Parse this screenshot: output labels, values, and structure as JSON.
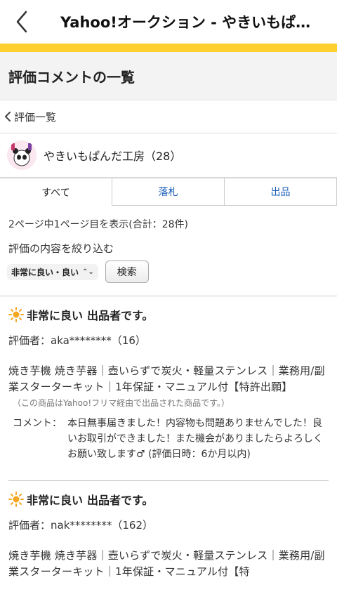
{
  "app": {
    "title": "Yahoo!オークション - やきいもぱ…"
  },
  "header": {
    "title": "評価コメントの一覧"
  },
  "breadcrumb": {
    "label": "評価一覧"
  },
  "seller": {
    "name": "やきいもぱんだ工房（28）"
  },
  "tabs": [
    {
      "label": "すべて",
      "active": true
    },
    {
      "label": "落札",
      "active": false
    },
    {
      "label": "出品",
      "active": false
    }
  ],
  "summary": {
    "text": "2ページ中1ページ目を表示(合計：28件)"
  },
  "filter": {
    "label": "評価の内容を絞り込む",
    "selected": "非常に良い・良い",
    "search_button": "検索"
  },
  "reviews": [
    {
      "rating": "非常に良い",
      "role": "出品者です。",
      "rater": "評価者：aka********（16）",
      "item_title": "焼き芋機 焼き芋器｜壺いらずで炭火・軽量ステンレス｜業務用/副業スターターキット｜1年保証・マニュアル付【特許出願】",
      "note": "（この商品はYahoo!フリマ経由で出品された商品です。）",
      "comment_label": "コメント：",
      "comment": "本日無事届きました！内容物も問題ありませんでした！良いお取引ができました！また機会がありましたらよろしくお願い致します♂ (評価日時：6か月以内)"
    },
    {
      "rating": "非常に良い",
      "role": "出品者です。",
      "rater": "評価者：nak********（162）",
      "item_title": "焼き芋機 焼き芋器｜壺いらずで炭火・軽量ステンレス｜業務用/副業スターターキット｜1年保証・マニュアル付【特"
    }
  ],
  "colors": {
    "accent": "#ffcf30",
    "link": "#1b5fb8",
    "sun": "#f5a623"
  },
  "icons": {
    "back": "chevron-left-icon",
    "breadcrumb": "chevron-left-icon",
    "rating": "sun-icon",
    "select": "updown-chevron-icon"
  }
}
